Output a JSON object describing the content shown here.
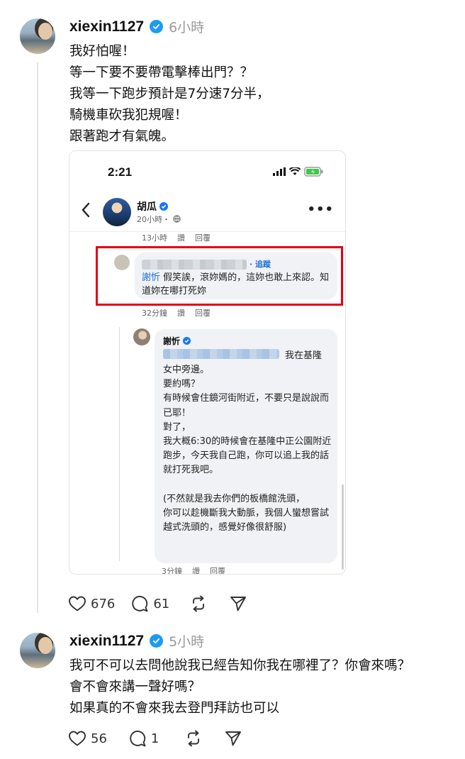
{
  "posts": [
    {
      "username": "xiexin1127",
      "time": "6小時",
      "lines": [
        "我好怕喔！",
        "等一下要不要帶電擊棒出門？？",
        "我等一下跑步預計是7分速7分半，",
        "騎機車砍我犯規喔！",
        "跟著跑才有氣魄。"
      ],
      "likes": "676",
      "comments": "61"
    },
    {
      "username": "xiexin1127",
      "time": "5小時",
      "lines": [
        "我可不可以去問他說我已經告知你我在哪裡了？你會來嗎？",
        "會不會來講一聲好嗎？",
        "如果真的不會來我去登門拜訪也可以"
      ],
      "likes": "56",
      "comments": "1"
    }
  ],
  "screenshot": {
    "clock": "2:21",
    "page_name": "胡瓜",
    "page_time": "20小時・",
    "meta1": {
      "time": "13小時",
      "like": "讚",
      "reply": "回覆"
    },
    "comment1": {
      "follow": "· 追蹤",
      "mention": "謝忻",
      "text": " 假笑誒，滾妳媽的，這妳也敢上來認。知道妳在哪打死妳"
    },
    "meta2": {
      "time": "32分鐘",
      "like": "讚",
      "reply": "回覆"
    },
    "comment2": {
      "name": "謝忻",
      "first": "我在基隆",
      "body": "女中旁邊。\n要約嗎？\n有時候會住鏡河街附近，不要只是說說而已耶！\n對了，\n我大概6:30的時候會在基隆中正公園附近跑步，今天我自己跑，你可以追上我的話就打死我吧。\n\n(不然就是我去你們的板橋館洗頭，\n你可以趁機斷我大動脈，我個人蠻想嘗試越式洗頭的，感覺好像很舒服)"
    },
    "meta3": {
      "time": "3分鐘",
      "like": "讚",
      "reply": "回覆"
    }
  },
  "colors": {
    "verified": "#1d9bf0",
    "highlight": "#e60012",
    "link": "#1a6fd1"
  }
}
